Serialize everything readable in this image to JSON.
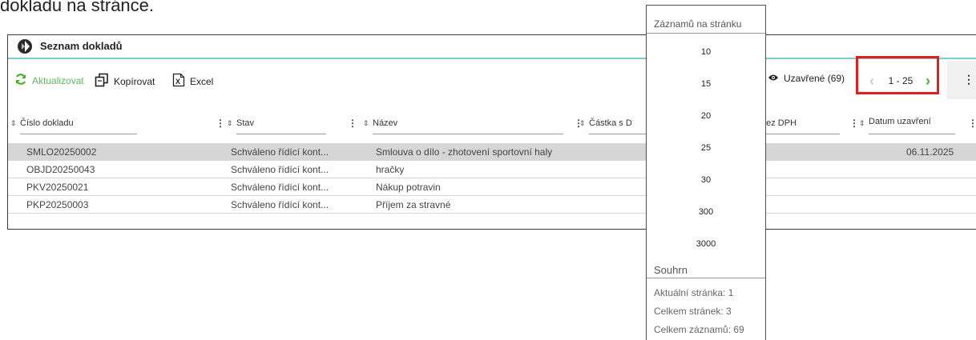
{
  "caption": "dokladu na stránce.",
  "panel": {
    "title": "Seznam dokladů"
  },
  "toolbar": {
    "refresh_label": "Aktualizovat",
    "copy_label": "Kopírovat",
    "excel_label": "Excel",
    "closed_filter_label": "Uzavřené (69)",
    "pager_range": "1 - 25"
  },
  "columns": [
    "Číslo dokladu",
    "Stav",
    "Název",
    "Částka s D",
    "bez DPH",
    "Datum uzavření"
  ],
  "rows": [
    {
      "number": "SMLO20250002",
      "state": "Schváleno řídící kont...",
      "name": "Smlouva o dílo - zhotovení sportovní haly",
      "date": "06.11.2025"
    },
    {
      "number": "OBJD20250043",
      "state": "Schváleno řídící kont...",
      "name": "hračky",
      "date": ""
    },
    {
      "number": "PKV20250021",
      "state": "Schváleno řídící kont...",
      "name": "Nákup potravin",
      "date": ""
    },
    {
      "number": "PKP20250003",
      "state": "Schváleno řídící kont...",
      "name": "Příjem za stravné",
      "date": ""
    }
  ],
  "page_size_menu": {
    "header": "Záznamů na stránku",
    "options": [
      "10",
      "15",
      "20",
      "25",
      "30",
      "300",
      "3000"
    ],
    "summary_header": "Souhrn",
    "current_page": "Aktuální stránka: 1",
    "total_pages": "Celkem stránek: 3",
    "total_records": "Celkem záznamů: 69"
  },
  "colors": {
    "accent_green": "#5cb85c",
    "highlight_red": "#e01f1f",
    "title_underline": "#7dc9d6",
    "selected_row": "#d6d6d6"
  }
}
